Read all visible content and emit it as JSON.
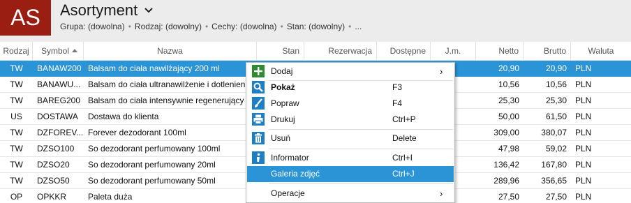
{
  "header": {
    "logo": "AS",
    "title": "Asortyment",
    "filters": [
      "Grupa: (dowolna)",
      "Rodzaj: (dowolny)",
      "Cechy: (dowolna)",
      "Stan: (dowolny)",
      "..."
    ],
    "filter_separator": "•",
    "logo_color": "#9b1e12"
  },
  "columns": {
    "rodzaj": "Rodzaj",
    "symbol": "Symbol",
    "nazwa": "Nazwa",
    "stan": "Stan",
    "rezerwacja": "Rezerwacja",
    "dostepne": "Dostępne",
    "jm": "J.m.",
    "netto": "Netto",
    "brutto": "Brutto",
    "waluta": "Waluta"
  },
  "rows": [
    {
      "rodzaj": "TW",
      "symbol": "BANAW200",
      "nazwa": "Balsam do ciała nawilżający 200 ml",
      "netto": "20,90",
      "brutto": "20,90",
      "waluta": "PLN"
    },
    {
      "rodzaj": "TW",
      "symbol": "BANAWU...",
      "nazwa": "Balsam do ciała ultranawilżenie i dotlenienie",
      "netto": "10,56",
      "brutto": "10,56",
      "waluta": "PLN"
    },
    {
      "rodzaj": "TW",
      "symbol": "BAREG200",
      "nazwa": "Balsam do ciała intensywnie regenerujący 200",
      "netto": "25,30",
      "brutto": "25,30",
      "waluta": "PLN"
    },
    {
      "rodzaj": "US",
      "symbol": "DOSTAWA",
      "nazwa": "Dostawa do klienta",
      "netto": "50,00",
      "brutto": "61,50",
      "waluta": "PLN"
    },
    {
      "rodzaj": "TW",
      "symbol": "DZFOREV...",
      "nazwa": "Forever dezodorant 100ml",
      "netto": "309,00",
      "brutto": "380,07",
      "waluta": "PLN"
    },
    {
      "rodzaj": "TW",
      "symbol": "DZSO100",
      "nazwa": "So dezodorant perfumowany 100ml",
      "netto": "47,98",
      "brutto": "59,02",
      "waluta": "PLN"
    },
    {
      "rodzaj": "TW",
      "symbol": "DZSO20",
      "nazwa": "So dezodorant perfumowany 20ml",
      "netto": "136,42",
      "brutto": "167,80",
      "waluta": "PLN"
    },
    {
      "rodzaj": "TW",
      "symbol": "DZSO50",
      "nazwa": "So dezodorant perfumowany 50ml",
      "netto": "289,96",
      "brutto": "356,65",
      "waluta": "PLN"
    },
    {
      "rodzaj": "OP",
      "symbol": "OPKKR",
      "nazwa": "Paleta duża",
      "netto": "27,50",
      "brutto": "27,50",
      "waluta": "PLN"
    }
  ],
  "context_menu": {
    "dodaj": {
      "label": "Dodaj",
      "icon": "plus-icon",
      "submenu": "›"
    },
    "pokaz": {
      "label": "Pokaż",
      "shortcut": "F3",
      "icon": "magnifier-icon"
    },
    "popraw": {
      "label": "Popraw",
      "shortcut": "F4",
      "icon": "brush-icon"
    },
    "drukuj": {
      "label": "Drukuj",
      "shortcut": "Ctrl+P",
      "icon": "printer-icon"
    },
    "usun": {
      "label": "Usuń",
      "shortcut": "Delete",
      "icon": "trash-icon"
    },
    "informator": {
      "label": "Informator",
      "shortcut": "Ctrl+I",
      "icon": "info-icon"
    },
    "galeria": {
      "label": "Galeria zdjęć",
      "shortcut": "Ctrl+J"
    },
    "operacje": {
      "label": "Operacje",
      "submenu": "›"
    }
  },
  "colors": {
    "selection": "#2b94d6",
    "add_icon": "#2e8b2e",
    "action_icon": "#1f7fc4"
  }
}
